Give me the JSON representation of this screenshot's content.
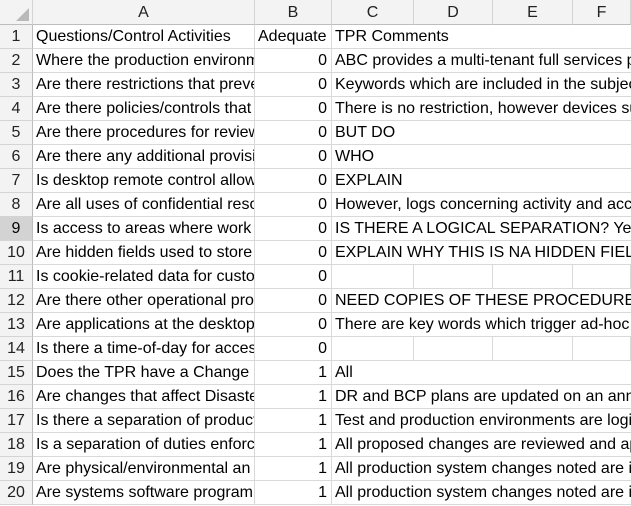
{
  "columns": [
    "A",
    "B",
    "C",
    "D",
    "E",
    "F"
  ],
  "selected_row": 9,
  "rows": [
    {
      "num": "1",
      "a": "Questions/Control Activities",
      "b": "Adequate",
      "c": "TPR Comments"
    },
    {
      "num": "2",
      "a": "Where the production environm",
      "b": "0",
      "c": "ABC provides a multi-tenant full services p"
    },
    {
      "num": "3",
      "a": "Are there restrictions that preve",
      "b": "0",
      "c": "Keywords which are included in the subjec"
    },
    {
      "num": "4",
      "a": "Are there policies/controls that",
      "b": "0",
      "c": "There is no restriction, however devices su"
    },
    {
      "num": "5",
      "a": "Are there procedures for review",
      "b": "0",
      "c": "BUT DO"
    },
    {
      "num": "6",
      "a": "Are there any additional provisi",
      "b": "0",
      "c": "WHO"
    },
    {
      "num": "7",
      "a": "Is desktop remote control allow",
      "b": "0",
      "c": "EXPLAIN"
    },
    {
      "num": "8",
      "a": "Are all uses of confidential reso",
      "b": "0",
      "c": "However, logs concerning activity and acc"
    },
    {
      "num": "9",
      "a": "Is access to areas where work",
      "b": "0",
      "c": "IS THERE A LOGICAL SEPARATION?  Yes"
    },
    {
      "num": "10",
      "a": "Are hidden fields used to store",
      "b": "0",
      "c": "EXPLAIN WHY THIS IS NA  HIDDEN FIELDS"
    },
    {
      "num": "11",
      "a": "Is cookie-related data for custo",
      "b": "0",
      "c": ""
    },
    {
      "num": "12",
      "a": "Are there other operational pro",
      "b": "0",
      "c": "NEED COPIES OF THESE PROCEDURES"
    },
    {
      "num": "13",
      "a": "Are applications at the desktop",
      "b": "0",
      "c": "There are key words which trigger ad-hoc"
    },
    {
      "num": "14",
      "a": "Is there a time-of-day for acces",
      "b": "0",
      "c": ""
    },
    {
      "num": "15",
      "a": "Does the TPR have a Change Co",
      "b": "1",
      "c": "All"
    },
    {
      "num": "16",
      "a": "Are changes that affect Disaste",
      "b": "1",
      "c": "DR and BCP plans are updated on an annu"
    },
    {
      "num": "17",
      "a": "Is there a separation of product",
      "b": "1",
      "c": "Test and production environments are logi"
    },
    {
      "num": "18",
      "a": "Is a separation of duties enforc",
      "b": "1",
      "c": "All proposed changes are reviewed and ap"
    },
    {
      "num": "19",
      "a": "Are physical/environmental an",
      "b": "1",
      "c": "All production system changes noted are i"
    },
    {
      "num": "20",
      "a": "Are systems software program",
      "b": "1",
      "c": "All production system changes noted are i"
    }
  ]
}
